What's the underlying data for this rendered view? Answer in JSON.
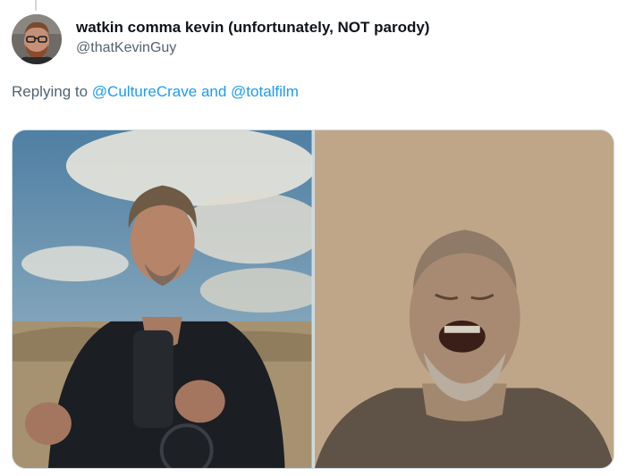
{
  "tweet": {
    "author": {
      "display_name": "watkin comma kevin (unfortunately, NOT parody)",
      "handle": "@thatKevinGuy",
      "avatar_icon": "profile-avatar-bearded-man-glasses"
    },
    "reply_context": {
      "prefix": "Replying to",
      "mentions": [
        "@CultureCrave",
        "@totalfilm"
      ],
      "conjunction": "and"
    },
    "media": [
      {
        "icon": "photo-man-with-camera-desert-sky"
      },
      {
        "icon": "photo-man-screaming-in-dust"
      }
    ]
  },
  "colors": {
    "link": "#1d9bf0",
    "secondary_text": "#536471",
    "primary_text": "#0f1419",
    "border": "#cfd9de"
  }
}
